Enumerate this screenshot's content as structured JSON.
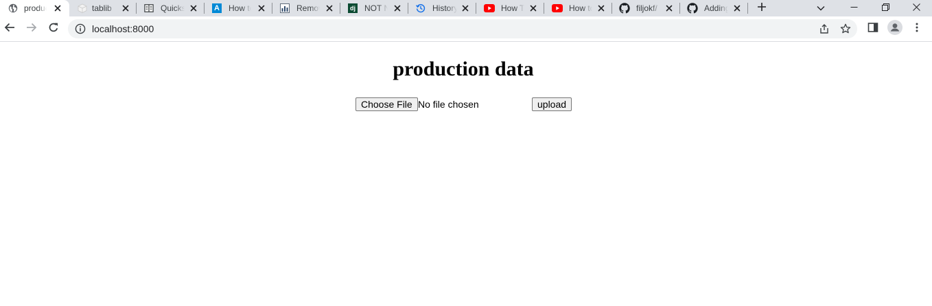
{
  "browser": {
    "tabs": [
      {
        "title": "production data",
        "favicon": "globe-icon",
        "active": true
      },
      {
        "title": "tablib",
        "favicon": "package-icon",
        "active": false
      },
      {
        "title": "Quickstart",
        "favicon": "book-icon",
        "active": false
      },
      {
        "title": "How to",
        "favicon": "azure-icon",
        "active": false
      },
      {
        "title": "Remove",
        "favicon": "chart-icon",
        "active": false
      },
      {
        "title": "NOT NULL",
        "favicon": "django-icon",
        "active": false
      },
      {
        "title": "History",
        "favicon": "history-icon",
        "active": false
      },
      {
        "title": "How To",
        "favicon": "youtube-icon",
        "active": false
      },
      {
        "title": "How to",
        "favicon": "youtube-icon",
        "active": false
      },
      {
        "title": "filjokf/",
        "favicon": "github-icon",
        "active": false
      },
      {
        "title": "Adding",
        "favicon": "github-icon",
        "active": false
      }
    ],
    "favicon_glyphs": {
      "azure": "A",
      "django": "dj"
    },
    "colors": {
      "tab_strip": "#dee1e6",
      "youtube_red": "#ff0000",
      "azure_blue": "#0089d6",
      "django_green": "#0c4b33",
      "history_blue": "#1a73e8"
    },
    "url": "localhost:8000"
  },
  "page": {
    "title": "production data",
    "choose_file_label": "Choose File",
    "file_status": "No file chosen",
    "upload_label": "upload"
  }
}
